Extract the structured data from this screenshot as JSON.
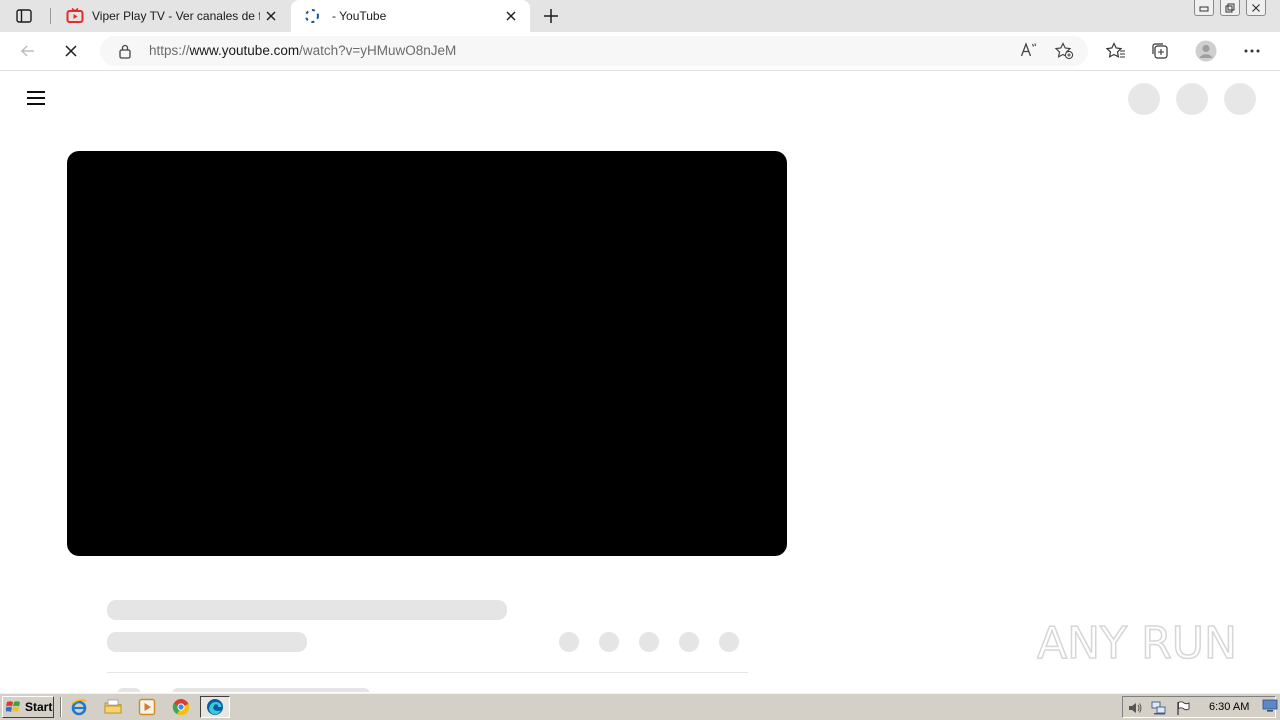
{
  "browser": {
    "tabs": [
      {
        "title": "Viper Play TV - Ver canales de fu",
        "icon": "youtube-tv-icon"
      },
      {
        "title": "- YouTube",
        "icon": "loading-spinner-icon"
      }
    ],
    "address": {
      "scheme": "https://",
      "host": "www.youtube.com",
      "path": "/watch?v=yHMuwO8nJeM"
    },
    "read_aloud_label": "Á"
  },
  "taskbar": {
    "start_label": "Start",
    "clock": "6:30 AM"
  },
  "watermark_text": "ANY RUN",
  "colors": {
    "tab_strip": "#e4e4e4",
    "skeleton": "#e5e5e5",
    "player": "#000000",
    "youtube_red": "#e52d27",
    "edge_blue": "#0c59a4"
  }
}
